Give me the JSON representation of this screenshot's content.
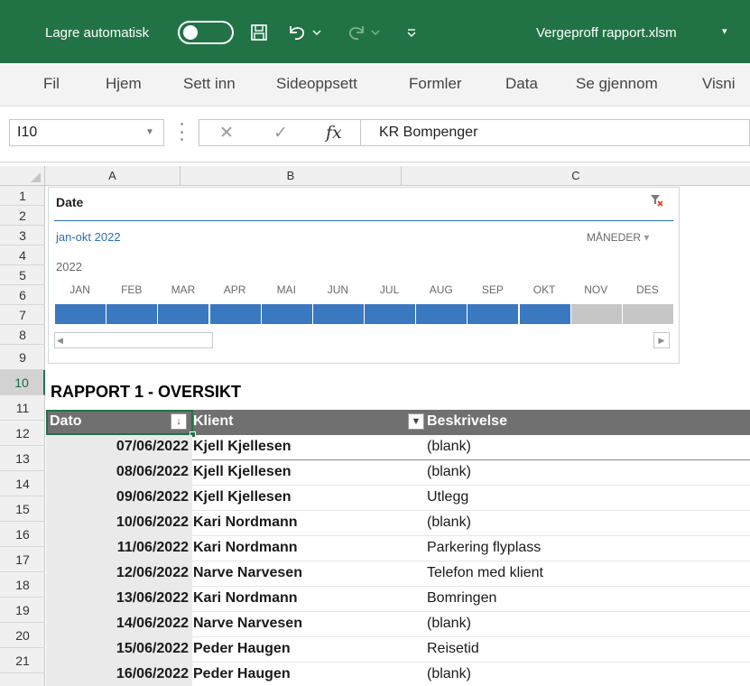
{
  "titlebar": {
    "autosave_label": "Lagre automatisk",
    "filename": "Vergeproff rapport.xlsm",
    "filename_caret": "▾"
  },
  "ribbon": {
    "tabs": [
      "Fil",
      "Hjem",
      "Sett inn",
      "Sideoppsett",
      "Formler",
      "Data",
      "Se gjennom",
      "Visni"
    ]
  },
  "formula_bar": {
    "name_box": "I10",
    "cancel_icon": "✕",
    "enter_icon": "✓",
    "fx_label": "fx",
    "formula": "KR Bompenger"
  },
  "columns": [
    "A",
    "B",
    "C"
  ],
  "row_numbers": [
    "1",
    "2",
    "3",
    "4",
    "5",
    "6",
    "7",
    "8",
    "9",
    "10",
    "11",
    "12",
    "13",
    "14",
    "15",
    "16",
    "17",
    "18",
    "19",
    "20",
    "21"
  ],
  "active_row": "10",
  "timeline": {
    "title": "Date",
    "range_label": "jan-okt 2022",
    "level_label": "MÅNEDER",
    "level_caret": "▾",
    "year": "2022",
    "months": [
      "JAN",
      "FEB",
      "MAR",
      "APR",
      "MAI",
      "JUN",
      "JUL",
      "AUG",
      "SEP",
      "OKT",
      "NOV",
      "DES"
    ],
    "selected_months": 10,
    "selected_color": "#3a78bf",
    "unselected_color": "#c6c6c6"
  },
  "report": {
    "title": "RAPPORT 1 - OVERSIKT",
    "headers": {
      "dato": "Dato",
      "klient": "Klient",
      "beskrivelse": "Beskrivelse",
      "sort_icon": "↓",
      "filter_icon": "▼"
    },
    "rows": [
      {
        "dato": "07/06/2022",
        "klient": "Kjell Kjellesen",
        "beskrivelse": "(blank)"
      },
      {
        "dato": "08/06/2022",
        "klient": "Kjell Kjellesen",
        "beskrivelse": "(blank)"
      },
      {
        "dato": "09/06/2022",
        "klient": "Kjell Kjellesen",
        "beskrivelse": "Utlegg"
      },
      {
        "dato": "10/06/2022",
        "klient": "Kari Nordmann",
        "beskrivelse": "(blank)"
      },
      {
        "dato": "11/06/2022",
        "klient": "Kari Nordmann",
        "beskrivelse": "Parkering flyplass"
      },
      {
        "dato": "12/06/2022",
        "klient": "Narve Narvesen",
        "beskrivelse": "Telefon med klient"
      },
      {
        "dato": "13/06/2022",
        "klient": "Kari Nordmann",
        "beskrivelse": "Bomringen"
      },
      {
        "dato": "14/06/2022",
        "klient": "Narve Narvesen",
        "beskrivelse": "(blank)"
      },
      {
        "dato": "15/06/2022",
        "klient": "Peder Haugen",
        "beskrivelse": "Reisetid"
      },
      {
        "dato": "16/06/2022",
        "klient": "Peder Haugen",
        "beskrivelse": "(blank)"
      }
    ]
  }
}
